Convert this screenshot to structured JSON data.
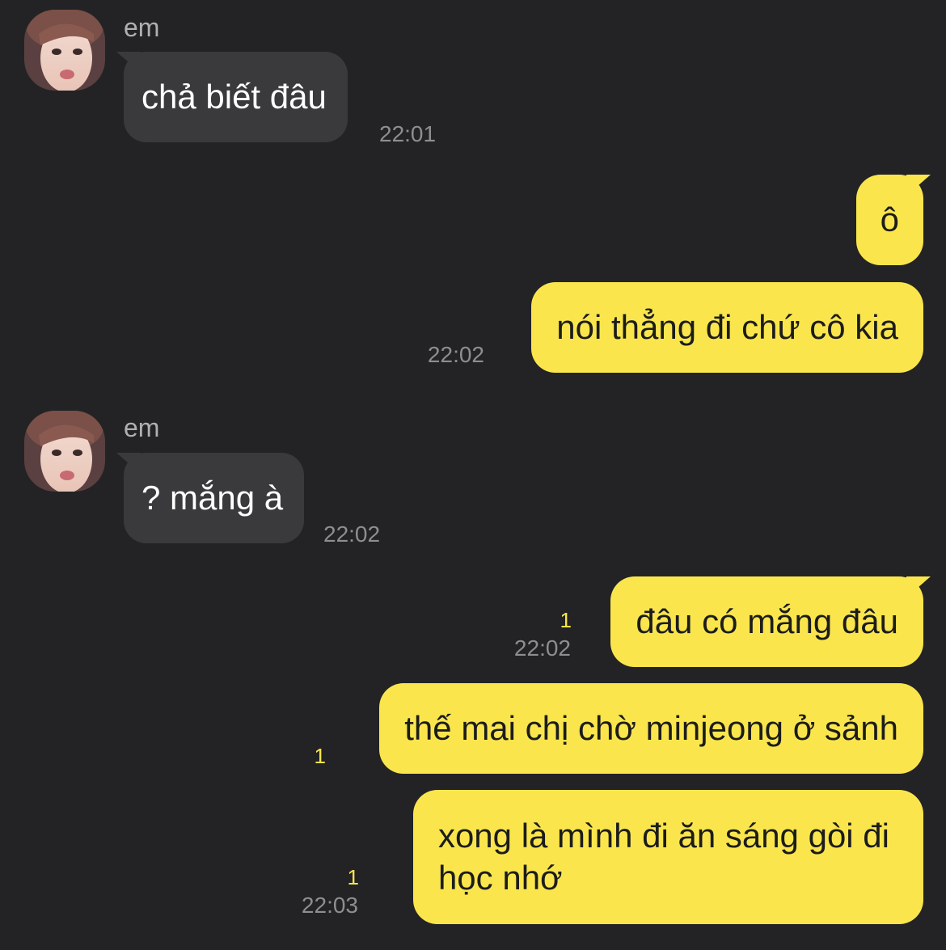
{
  "messages": [
    {
      "direction": "incoming",
      "sender": "em",
      "avatar": "contact-avatar-photo",
      "text": "chả biết đâu",
      "time": "22:01"
    },
    {
      "direction": "outgoing",
      "text": "ô"
    },
    {
      "direction": "outgoing",
      "text": "nói thẳng đi chứ cô kia",
      "time": "22:02"
    },
    {
      "direction": "incoming",
      "sender": "em",
      "avatar": "contact-avatar-photo",
      "text": "? mắng à",
      "time": "22:02"
    },
    {
      "direction": "outgoing",
      "text": "đâu có mắng đâu",
      "time": "22:02",
      "unread": "1"
    },
    {
      "direction": "outgoing",
      "text": "thế mai chị chờ minjeong ở sảnh",
      "unread": "1"
    },
    {
      "direction": "outgoing",
      "text_lines": [
        "xong là mình đi ăn sáng gòi đi",
        "học nhớ"
      ],
      "time": "22:03",
      "unread": "1"
    }
  ],
  "colors": {
    "background": "#232325",
    "incoming_bubble": "#3a3a3d",
    "outgoing_bubble": "#fae64c",
    "timestamp": "#8e8e92",
    "unread_badge": "#fae64c"
  }
}
